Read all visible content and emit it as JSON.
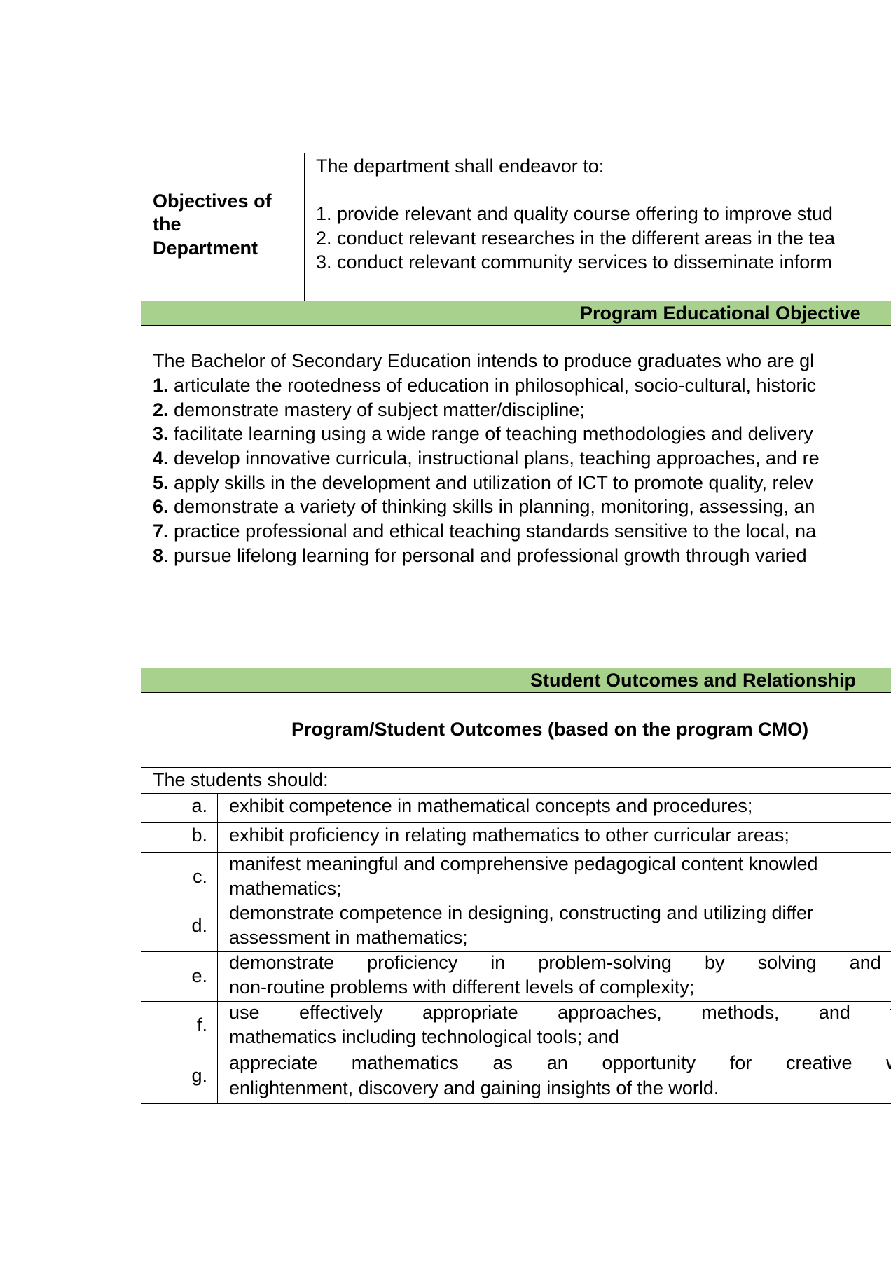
{
  "objectives": {
    "label_lines": [
      "Objectives of",
      "the",
      "Department"
    ],
    "intro": "The department shall endeavor to:",
    "items": [
      "1. provide relevant and quality course offering to improve stud",
      "2. conduct relevant researches in the different areas in the tea",
      "3. conduct relevant community services to disseminate inform"
    ]
  },
  "peo": {
    "header": "Program Educational Objective",
    "intro": "The Bachelor of Secondary Education intends to produce graduates who are gl",
    "items": [
      {
        "num": "1.",
        "text": " articulate the rootedness of education in philosophical, socio-cultural, historic"
      },
      {
        "num": "2.",
        "text": " demonstrate mastery of subject matter/discipline;"
      },
      {
        "num": "3.",
        "text": " facilitate learning using a wide range of teaching methodologies and delivery"
      },
      {
        "num": "4.",
        "text": " develop innovative curricula, instructional plans, teaching approaches, and re"
      },
      {
        "num": "5.",
        "text": " apply skills in the development and utilization of ICT to promote quality, relev"
      },
      {
        "num": "6.",
        "text": " demonstrate a variety of thinking skills in planning, monitoring, assessing, an"
      },
      {
        "num": "7.",
        "text": " practice professional and ethical teaching standards sensitive to the local, na"
      },
      {
        "num": "8",
        "text": ". pursue lifelong learning for personal and professional growth through varied"
      }
    ]
  },
  "outcomes": {
    "header": "Student Outcomes and Relationship",
    "subheader": "Program/Student Outcomes (based on the program CMO)",
    "intro": "The students should:",
    "items": [
      {
        "letter": "a.",
        "lines": [
          "exhibit competence in mathematical concepts and procedures;"
        ]
      },
      {
        "letter": "b.",
        "lines": [
          "exhibit proficiency in relating mathematics to other curricular areas;"
        ]
      },
      {
        "letter": "c.",
        "lines": [
          "manifest meaningful and comprehensive pedagogical content knowled",
          "mathematics;"
        ]
      },
      {
        "letter": "d.",
        "lines": [
          "demonstrate competence in designing, constructing and utilizing differ",
          "assessment in mathematics;"
        ]
      },
      {
        "letter": "e.",
        "lines": [
          "demonstrate proficiency in problem-solving by solving and creating",
          "non-routine problems with different levels of complexity;"
        ]
      },
      {
        "letter": "f.",
        "lines": [
          "use effectively appropriate approaches, methods, and techniques",
          "mathematics including technological tools; and"
        ]
      },
      {
        "letter": "g.",
        "lines": [
          "appreciate mathematics as an opportunity for creative work, m",
          "enlightenment, discovery and gaining insights of the world."
        ]
      }
    ]
  }
}
